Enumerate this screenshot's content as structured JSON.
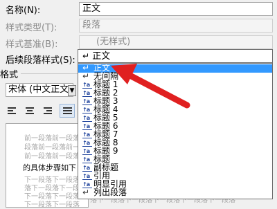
{
  "dialog": {
    "name_label": "名称",
    "name_mnemonic": "(N):",
    "name_value": "正文",
    "type_label": "样式类型",
    "type_mnemonic": "(T):",
    "type_value": "段落",
    "base_label": "样式基准",
    "base_mnemonic": "(B):",
    "base_value": "(无样式)",
    "next_label": "后续段落样式",
    "next_mnemonic": "(S):",
    "next_value": "正文",
    "format_heading": "格式",
    "font_value": "宋体 (中文正文"
  },
  "preview": {
    "lines": [
      "前一段落前一段落前一段落",
      "段落前一段落前一段落前一",
      "前一段落前一段落前一段落",
      "的具体步骤如下",
      "下一段落下一段落下一段落",
      "落下一段落下一段落下一段",
      "下一段落下一段落下一段落",
      "落下一段落下一段落下一段落下一段落下一段落",
      "下一段落下一段落"
    ]
  },
  "style_list": {
    "items": [
      {
        "label": "正文",
        "icon": "paragraph-mark-icon",
        "selected": true
      },
      {
        "label": "无间隔",
        "icon": "paragraph-mark-icon",
        "selected": false
      },
      {
        "label": "标题 1",
        "icon": "heading-icon",
        "selected": false
      },
      {
        "label": "标题 2",
        "icon": "heading-icon",
        "selected": false
      },
      {
        "label": "标题 3",
        "icon": "heading-icon",
        "selected": false
      },
      {
        "label": "标题 4",
        "icon": "heading-icon",
        "selected": false
      },
      {
        "label": "标题 5",
        "icon": "heading-icon",
        "selected": false
      },
      {
        "label": "标题 6",
        "icon": "heading-icon",
        "selected": false
      },
      {
        "label": "标题 7",
        "icon": "heading-icon",
        "selected": false
      },
      {
        "label": "标题 8",
        "icon": "heading-icon",
        "selected": false
      },
      {
        "label": "标题 9",
        "icon": "heading-icon",
        "selected": false
      },
      {
        "label": "标题",
        "icon": "heading-icon",
        "selected": false
      },
      {
        "label": "副标题",
        "icon": "heading-icon",
        "selected": false
      },
      {
        "label": "引用",
        "icon": "heading-icon",
        "selected": false
      },
      {
        "label": "明显引用",
        "icon": "heading-icon",
        "selected": false
      },
      {
        "label": "列出段落",
        "icon": "paragraph-mark-icon",
        "selected": false
      }
    ]
  },
  "colors": {
    "selection": "#3399ff",
    "arrow": "#e02020",
    "heading_icon": "#1a3f9a"
  }
}
